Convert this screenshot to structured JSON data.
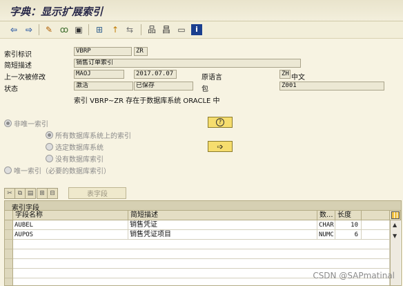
{
  "window": {
    "title": "字典：显示扩展索引"
  },
  "toolbar": {
    "icons": [
      "back-arrow-icon",
      "forward-arrow-icon",
      "pencil-icon",
      "glasses-icon",
      "object-list-icon",
      "hierarchy-icon",
      "info-pointer-icon",
      "transport-icon",
      "menu-tree-icon",
      "print-icon",
      "window-icon",
      "info-icon"
    ]
  },
  "header": {
    "index_id_label": "索引标识",
    "table_name": "VBRP",
    "index_id": "ZR",
    "short_desc_label": "简短描述",
    "short_desc": "销售订单索引",
    "last_changed_label": "上一次被修改",
    "changed_by": "MAOJ",
    "changed_date": "2017.07.07",
    "orig_lang_label": "原语言",
    "orig_lang_code": "ZH",
    "orig_lang_name": "中文",
    "status_label": "状态",
    "status_active": "激活",
    "status_saved": "已保存",
    "package_label": "包",
    "package": "Z001",
    "db_message": "索引 VBRP~ZR 存在于数据库系统 ORACLE 中"
  },
  "options": {
    "non_unique": "非唯一索引",
    "all_db": "所有数据库系统上的索引",
    "selected_db": "选定数据库系统",
    "no_db": "没有数据库索引",
    "unique": "唯一索引（必要的数据库索引）"
  },
  "fields_table": {
    "toolbar_button": "表字段",
    "title": "索引字段",
    "columns": [
      "字段名称",
      "简短描述",
      "数...",
      "长度"
    ],
    "rows": [
      {
        "name": "AUBEL",
        "desc": "销售凭证",
        "type": "CHAR",
        "len": "10"
      },
      {
        "name": "AUPOS",
        "desc": "销售凭证项目",
        "type": "NUMC",
        "len": "6"
      }
    ]
  },
  "watermark": "CSDN @SAPmatinal",
  "colors": {
    "background": "#f7f3e2",
    "button_yellow": "#f6dd6e"
  }
}
